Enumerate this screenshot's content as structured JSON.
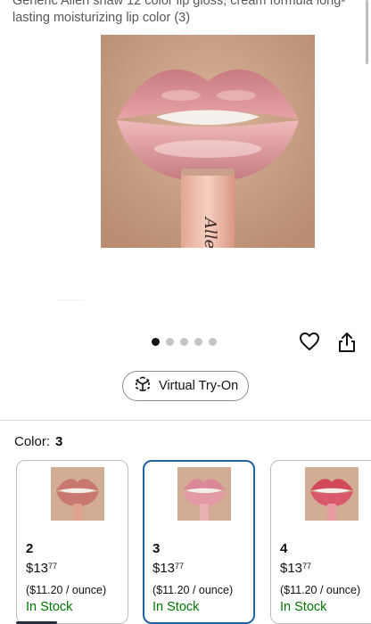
{
  "product": {
    "title": "Generic Allen shaw 12 color lip gloss, cream formula long-lasting moisturizing lip color (3)",
    "image_icon": "lip-gloss-product-photo",
    "image_brand_text": "Allen S"
  },
  "carousel": {
    "total": 5,
    "active_index": 0
  },
  "actions": {
    "favorite_icon": "heart-icon",
    "share_icon": "share-icon"
  },
  "try_on": {
    "label": "Virtual Try-On",
    "icon": "cube-icon"
  },
  "color_selector": {
    "label": "Color:",
    "selected": "3",
    "options": [
      {
        "name": "2",
        "price_main": "13",
        "price_fraction": "77",
        "unit_price": "($11.20 / ounce)",
        "stock": "In Stock",
        "selected": false,
        "swatch": "#c87870"
      },
      {
        "name": "3",
        "price_main": "13",
        "price_fraction": "77",
        "unit_price": "($11.20 / ounce)",
        "stock": "In Stock",
        "selected": true,
        "swatch": "#d98a96"
      },
      {
        "name": "4",
        "price_main": "13",
        "price_fraction": "77",
        "unit_price": "($11.20 / ounce)",
        "stock": "In Stock",
        "selected": false,
        "swatch": "#d04a5c"
      }
    ]
  },
  "colors": {
    "accent": "#2162a1",
    "in_stock": "#007600",
    "text": "#0f1111"
  }
}
